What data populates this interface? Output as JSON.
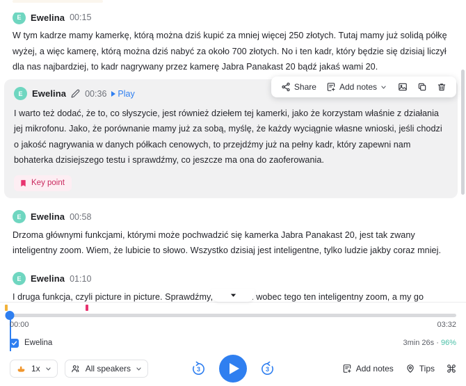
{
  "transcript": {
    "blocks": [
      {
        "avatar_initial": "E",
        "speaker": "Ewelina",
        "timestamp": "00:15",
        "text": "W tym kadrze mamy kamerkę, którą można dziś kupić za mniej więcej 250 złotych. Tutaj mamy już solidą półkę wyżej, a więc kamerę, którą można dziś nabyć za około 700 złotych. No i ten kadr, który będzie się dzisiaj liczył dla nas najbardziej, to kadr nagrywany przez kamerę Jabra Panakast 20 bądź jakaś wami 20."
      },
      {
        "avatar_initial": "E",
        "speaker": "Ewelina",
        "timestamp": "00:36",
        "play_label": "Play",
        "text": "I warto też dodać, że to, co słyszycie, jest również dziełem tej kamerki, jako że korzystam właśnie z działania jej mikrofonu. Jako, że porównanie mamy już za sobą, myślę, że każdy wyciągnie własne wnioski, jeśli chodzi o jakość nagrywania w danych półkach cenowych, to przejdźmy już na pełny kadr, który zapewni nam bohaterka dzisiejszego testu i sprawdźmy, co jeszcze ma ona do zaoferowania.",
        "badge": "Key point"
      },
      {
        "avatar_initial": "E",
        "speaker": "Ewelina",
        "timestamp": "00:58",
        "text": "Drzoma głównymi funkcjami, którymi może pochwadzić się kamerka Jabra Panakast 20, jest tak zwany inteligentny zoom. Wiem, że lubicie to słowo. Wszystko dzisiaj jest inteligentne, tylko ludzie jakby coraz mniej."
      },
      {
        "avatar_initial": "E",
        "speaker": "Ewelina",
        "timestamp": "01:10",
        "text": "I druga funkcja, czyli picture in picture. Sprawdźmy, co potrafił wobec tego ten inteligentny zoom, a my go właśnie aktywowanego. To nie tylko zoom. Oprac powiem więcej niż tysiąc zoom, więc ja po prostu się poprzemieszczam, a wy"
      }
    ]
  },
  "block_toolbar": {
    "share_label": "Share",
    "add_notes_label": "Add notes",
    "share_icon": "share-icon",
    "notes_icon": "add-notes-icon",
    "chevron_icon": "chevron-down-icon",
    "image_icon": "image-icon",
    "copy_icon": "copy-icon",
    "delete_icon": "trash-icon"
  },
  "timeline": {
    "start_time": "00:00",
    "end_time": "03:32",
    "playhead_percent": 0,
    "markers": [
      {
        "name": "note-marker",
        "position_percent": 1,
        "color": "#f2b23a"
      },
      {
        "name": "key-point-marker",
        "position_percent": 18,
        "color": "#e8336f"
      }
    ]
  },
  "speaker_track": {
    "name": "Ewelina",
    "checked": true,
    "duration": "3min 26s",
    "separator": "·",
    "percent": "96%",
    "wave_color": "#7fd9c5"
  },
  "bottom_bar": {
    "speed_label": "1x",
    "speed_icon": "speed-hand-icon",
    "speakers_label": "All speakers",
    "speakers_icon": "people-icon",
    "rewind_seconds": "3",
    "forward_seconds": "3",
    "play_icon": "play-icon",
    "add_notes_label": "Add notes",
    "add_notes_icon": "add-notes-icon",
    "tips_label": "Tips",
    "tips_icon": "pin-icon",
    "fullscreen_icon": "command-icon"
  },
  "colors": {
    "accent_blue": "#2f7ff0",
    "avatar_teal": "#6fd6c0",
    "keypoint_pink": "#c9285e",
    "keypoint_bg": "#fdeef3",
    "highlight_bg": "#f1f1f2",
    "track_teal": "#4bc0a8"
  }
}
